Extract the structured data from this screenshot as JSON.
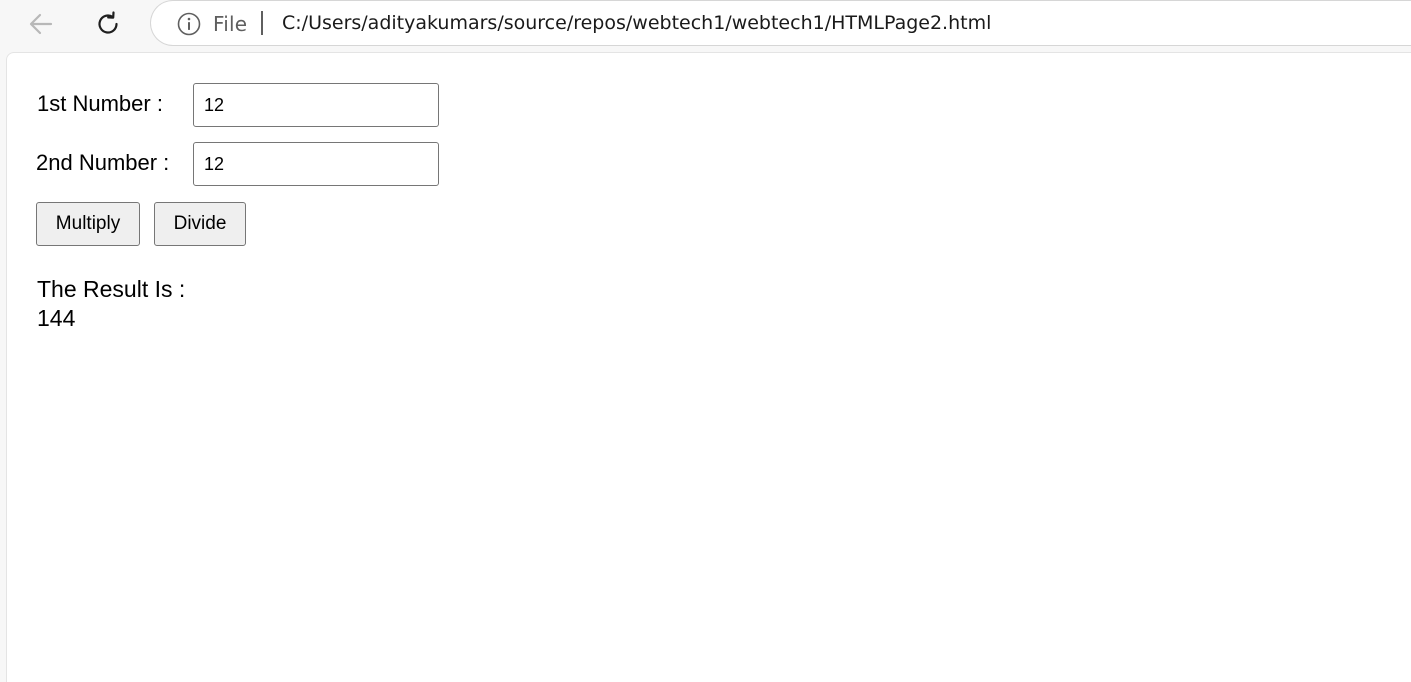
{
  "browser": {
    "scheme_label": "File",
    "url": "C:/Users/adityakumars/source/repos/webtech1/webtech1/HTMLPage2.html",
    "icons": {
      "back": "back-arrow-icon",
      "reload": "reload-icon",
      "info": "info-icon"
    }
  },
  "form": {
    "first_label": "1st Number :",
    "first_value": "12",
    "second_label": "2nd Number :",
    "second_value": "12",
    "multiply_label": "Multiply",
    "divide_label": "Divide"
  },
  "result": {
    "label": "The Result Is :",
    "value": "144"
  }
}
